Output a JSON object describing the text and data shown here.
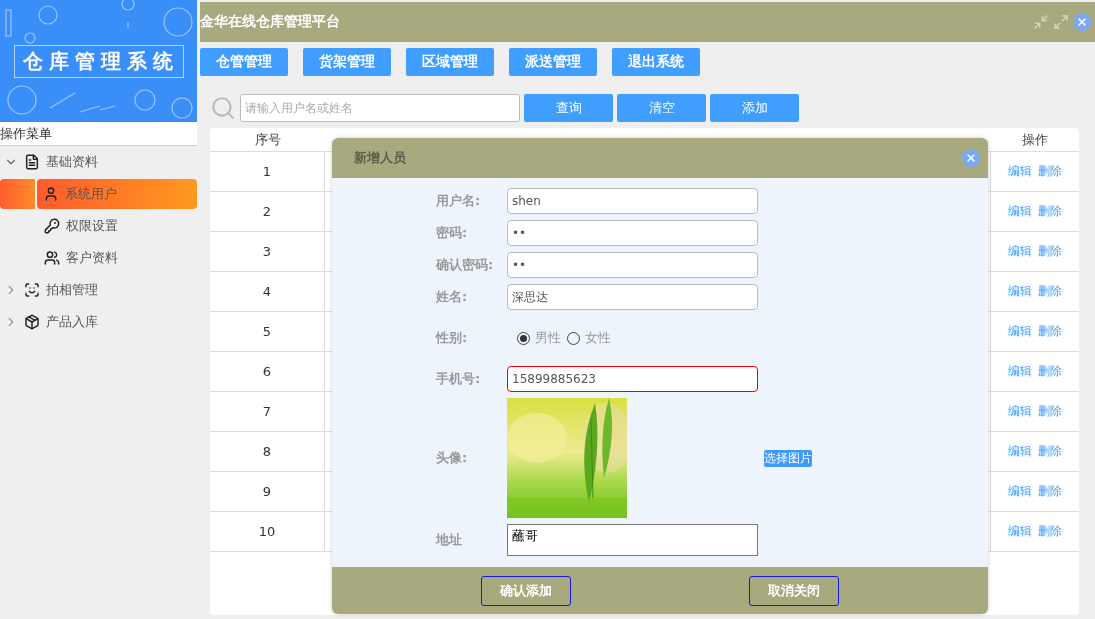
{
  "sidebar": {
    "banner_title": "仓库管理系统",
    "menu_heading": "操作菜单",
    "items": [
      {
        "label": "基础资料",
        "expanded": true,
        "selected": false,
        "children": [
          {
            "label": "系统用户",
            "selected": true
          },
          {
            "label": "权限设置",
            "selected": false
          },
          {
            "label": "客户资料",
            "selected": false
          }
        ]
      },
      {
        "label": "拍相管理",
        "expanded": false,
        "selected": false
      },
      {
        "label": "产品入库",
        "expanded": false,
        "selected": false
      }
    ]
  },
  "header": {
    "title": "金华在线仓库管理平台"
  },
  "nav_buttons": [
    "仓管管理",
    "货架管理",
    "区域管理",
    "派送管理",
    "退出系统"
  ],
  "search": {
    "placeholder": "请输入用户名或姓名",
    "buttons": [
      "查询",
      "清空",
      "添加"
    ]
  },
  "table": {
    "columns": [
      "序号",
      "操作"
    ],
    "rows": [
      {
        "index": "1",
        "actions": [
          "编辑",
          "删除"
        ]
      },
      {
        "index": "2",
        "actions": [
          "编辑",
          "删除"
        ]
      },
      {
        "index": "3",
        "actions": [
          "编辑",
          "删除"
        ]
      },
      {
        "index": "4",
        "actions": [
          "编辑",
          "删除"
        ]
      },
      {
        "index": "5",
        "actions": [
          "编辑",
          "删除"
        ]
      },
      {
        "index": "6",
        "actions": [
          "编辑",
          "删除"
        ]
      },
      {
        "index": "7",
        "actions": [
          "编辑",
          "删除"
        ]
      },
      {
        "index": "8",
        "actions": [
          "编辑",
          "删除"
        ]
      },
      {
        "index": "9",
        "actions": [
          "编辑",
          "删除"
        ]
      },
      {
        "index": "10",
        "actions": [
          "编辑",
          "删除"
        ]
      }
    ]
  },
  "dialog": {
    "title": "新增人员",
    "fields": [
      {
        "kind": "text",
        "label": "用户名:",
        "value": "shen",
        "invalid": false
      },
      {
        "kind": "text",
        "label": "密码:",
        "value": "••",
        "invalid": false
      },
      {
        "kind": "text",
        "label": "确认密码:",
        "value": "••",
        "invalid": false
      },
      {
        "kind": "text",
        "label": "姓名:",
        "value": "深思达",
        "invalid": false
      },
      {
        "kind": "radio",
        "label": "性别:",
        "options": [
          {
            "label": "男性",
            "selected": true
          },
          {
            "label": "女性",
            "selected": false
          }
        ]
      },
      {
        "kind": "text",
        "label": "手机号:",
        "value": "15899885623",
        "invalid": true
      },
      {
        "label": "头像:",
        "link": "选择图片"
      },
      {
        "kind": "textarea",
        "label": "地址",
        "value": "蘸哥"
      }
    ],
    "buttons": [
      "确认添加",
      "取消关闭"
    ]
  }
}
